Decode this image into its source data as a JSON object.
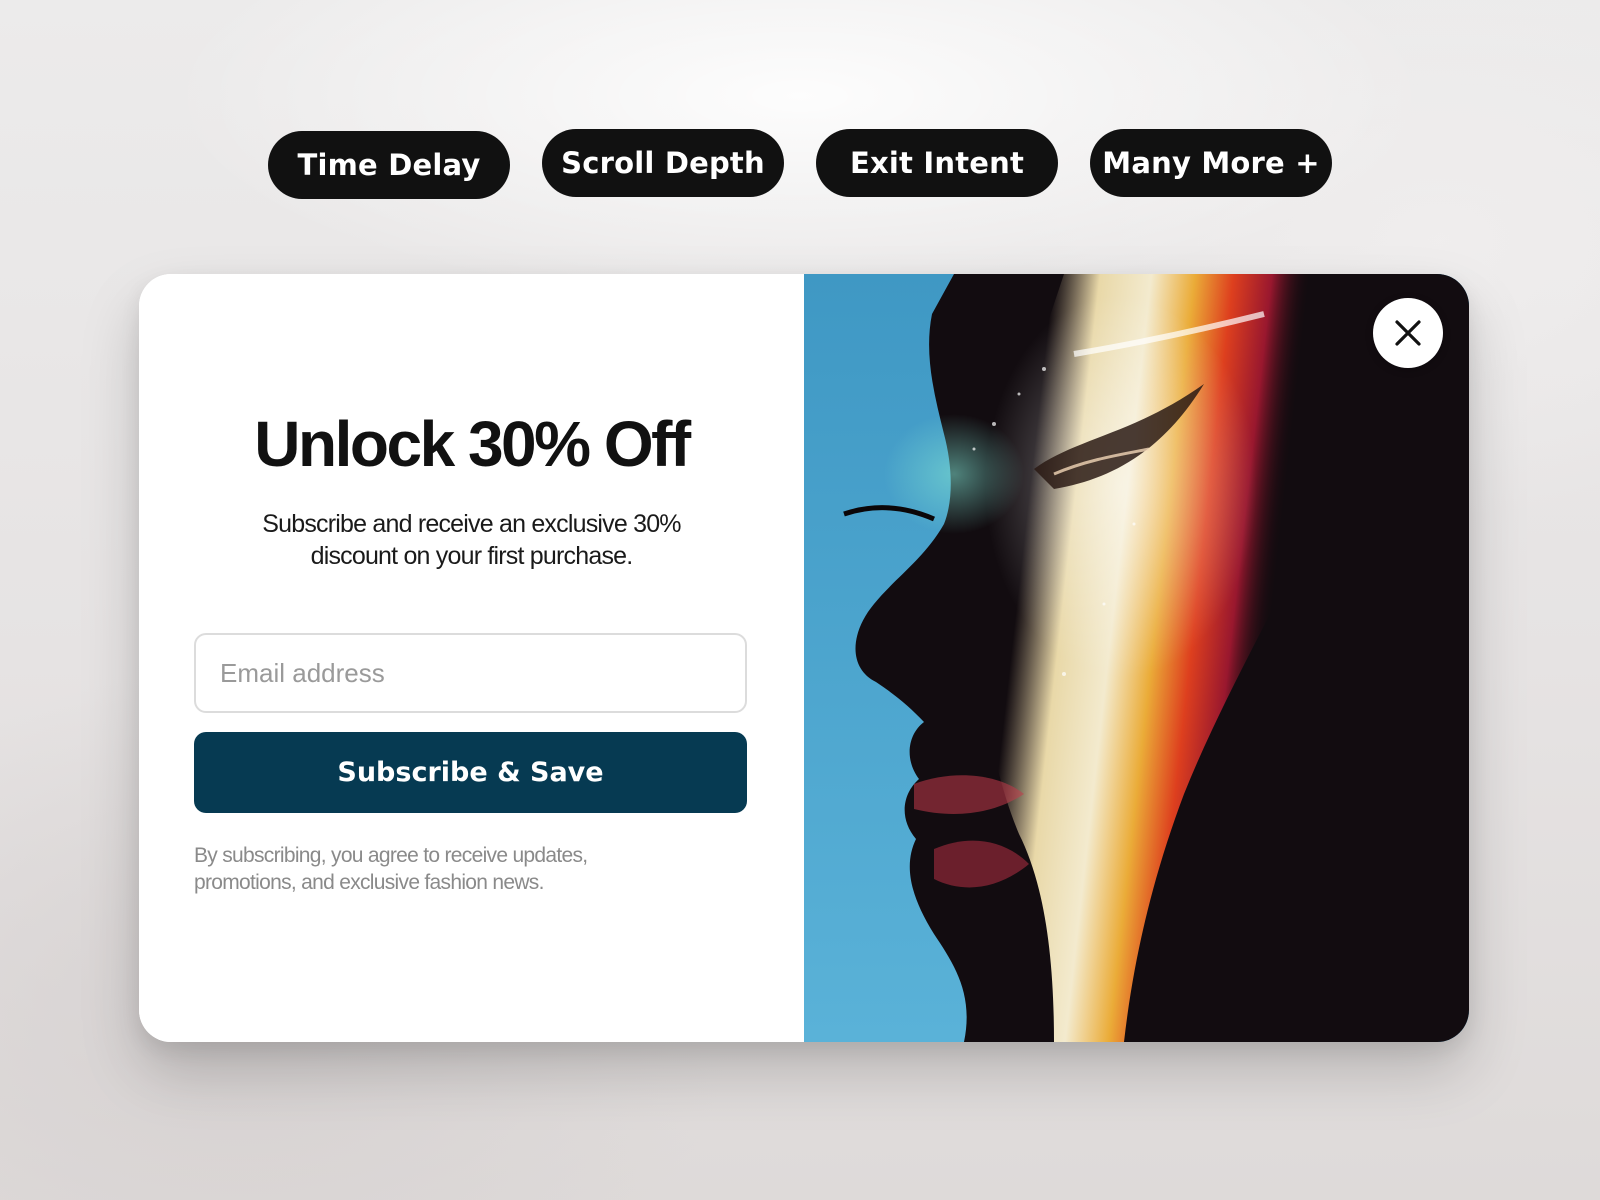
{
  "triggers": [
    {
      "label": "Time Delay"
    },
    {
      "label": "Scroll Depth"
    },
    {
      "label": "Exit Intent"
    },
    {
      "label": "Many More +"
    }
  ],
  "popup": {
    "headline": "Unlock 30% Off",
    "subtext": "Subscribe and receive an exclusive 30% discount on your first purchase.",
    "email_placeholder": "Email address",
    "email_value": "",
    "subscribe_label": "Subscribe & Save",
    "disclaimer": "By subscribing, you agree to receive updates, promotions, and exclusive fashion news.",
    "close_icon": "close-icon",
    "image_subject": "portrait-photo"
  },
  "colors": {
    "pill_bg": "#111111",
    "button_bg": "#063a52",
    "image_bg": "#4fa6cf"
  }
}
